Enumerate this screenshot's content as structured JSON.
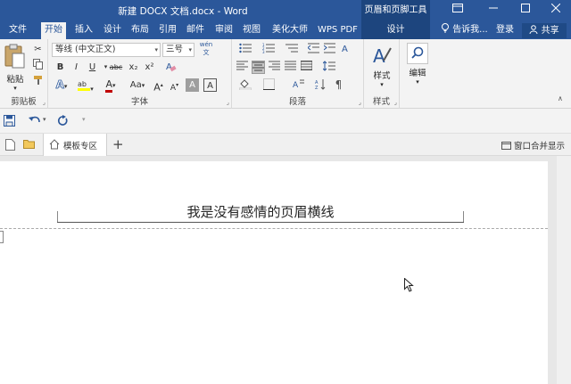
{
  "titlebar": {
    "doc_title": "新建 DOCX 文档.docx - Word",
    "context_title": "页眉和页脚工具",
    "ribbon_display_icon": "ribbon-display-options-icon",
    "minimize_icon": "minimize-icon",
    "restore_icon": "restore-icon",
    "close_icon": "close-icon"
  },
  "tabs": [
    "文件",
    "开始",
    "插入",
    "设计",
    "布局",
    "引用",
    "邮件",
    "审阅",
    "视图",
    "美化大师",
    "WPS PDF"
  ],
  "active_tab": "开始",
  "context_tab": "设计",
  "tell_me": "告诉我...",
  "login": "登录",
  "share": "共享",
  "ribbon": {
    "clipboard": {
      "label": "剪贴板",
      "paste": "粘贴"
    },
    "font": {
      "label": "字体",
      "font_name": "等线 (中文正文)",
      "font_size": "三号",
      "pinyin": "wén",
      "bold": "B",
      "italic": "I",
      "underline": "U",
      "strike": "abc",
      "subscript": "x₂",
      "superscript": "x²",
      "grow": "A",
      "shrink": "A",
      "case": "Aa",
      "clear": "A",
      "color_a": "A",
      "highlight_icon": "highlight-icon",
      "text_effect_icon": "text-effect-icon",
      "char_shade": "A",
      "char_border": "A"
    },
    "paragraph": {
      "label": "段落"
    },
    "styles": {
      "label": "样式",
      "button": "样式"
    },
    "editing": {
      "button": "编辑"
    }
  },
  "qat": {
    "save_icon": "save-icon",
    "undo_icon": "undo-icon",
    "redo_icon": "redo-icon"
  },
  "doc_tabs": {
    "template_tab": "模板专区",
    "add": "+",
    "merge_windows": "窗口合并显示"
  },
  "document": {
    "header_text": "我是没有感情的页眉横线"
  },
  "colors": {
    "accent": "#2b579a",
    "context": "#1d457e",
    "ribbon_bg": "#f3f3f3",
    "font_color_bar": "#c00000",
    "highlight_bar": "#ffff00"
  }
}
